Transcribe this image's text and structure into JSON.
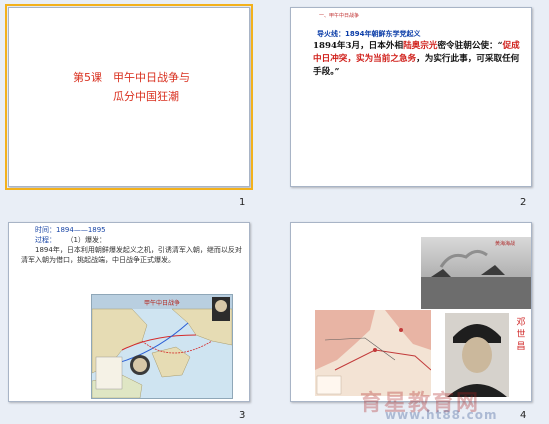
{
  "slides": [
    {
      "number": "1",
      "title_line1": "第5课　甲午中日战争与",
      "title_line2": "瓜分中国狂潮"
    },
    {
      "number": "2",
      "tiny_header": "一、甲午中日战争",
      "fuse_heading": "导火线：1894年朝鲜东学党起义",
      "body_part1": "1894年3月，日本外相",
      "body_red1": "陆奥宗光",
      "body_part2": "密令驻朝公使：“",
      "body_red2": "促成中日冲突，实为当前之急务",
      "body_part3": "，为实行此事，可采取任何手段。”"
    },
    {
      "number": "3",
      "time_line": "时间：1894——1895",
      "process_label": "过程：",
      "process_item": "（1）爆发：",
      "para": "1894年，日本利用朝鲜爆发起义之机，引诱清军入朝，继而以反对清军入朝为借口，挑起战端，中日战争正式爆发。",
      "map_title": "甲午中日战争"
    },
    {
      "number": "4",
      "photo_caption": "黄海海战",
      "portrait_name": "邓世昌"
    }
  ],
  "watermark": {
    "text": "育星教育网",
    "url": "www.ht88.com"
  }
}
